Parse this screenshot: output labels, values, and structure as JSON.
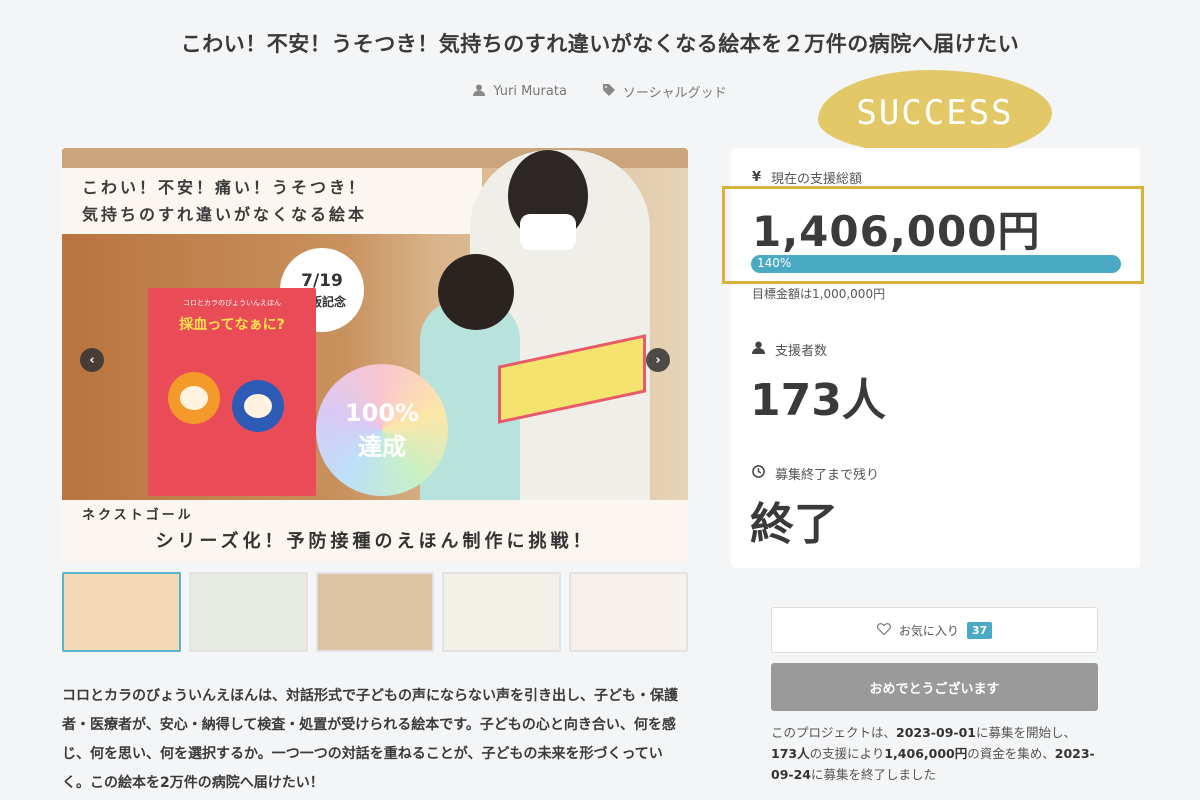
{
  "page": {
    "title": "こわい！不安！うそつき！気持ちのすれ違いがなくなる絵本を２万件の病院へ届けたい",
    "author": "Yuri Murata",
    "category": "ソーシャルグッド",
    "success_badge": "SUCCESS"
  },
  "hero": {
    "banner_line1": "こわい！不安！痛い！うそつき！",
    "banner_line2": "気持ちのすれ違いがなくなる絵本",
    "date": "7/19",
    "date_sub": "出版記念",
    "book_series": "コロとカラのびょういんえほん",
    "book_title": "採血ってなぁに?",
    "achieved_percent": "100%",
    "achieved_label": "達成",
    "next_goal": "ネクストゴール",
    "next_goal_text": "シリーズ化！予防接種のえほん制作に挑戦！",
    "prev_arrow": "‹",
    "next_arrow": "›"
  },
  "thumbnails": [
    {
      "color": "#f3d9b4",
      "active": true
    },
    {
      "color": "#e8ebe4",
      "active": false
    },
    {
      "color": "#dcc3a3",
      "active": false
    },
    {
      "color": "#f2efe6",
      "active": false
    },
    {
      "color": "#f5f1ea",
      "active": false
    }
  ],
  "description": "コロとカラのびょういんえほんは、対話形式で子どもの声にならない声を引き出し、子ども・保護者・医療者が、安心・納得して検査・処置が受けられる絵本です。子どもの心と向き合い、何を感じ、何を思い、何を選択するか。一つ一つの対話を重ねることが、子どもの未来を形づくっていく。この絵本を2万件の病院へ届けたい！",
  "stats": {
    "total_label": "現在の支援総額",
    "yen_icon": "¥",
    "total_amount": "1,406,000円",
    "progress_text": "140%",
    "progress_value": 1.4,
    "goal_text": "目標金額は1,000,000円",
    "supporters_label": "支援者数",
    "supporters": "173人",
    "remaining_label": "募集終了まで残り",
    "remaining": "終了"
  },
  "actions": {
    "favorite_label": "お気に入り",
    "favorite_count": "37",
    "congrats_label": "おめでとうございます"
  },
  "summary": {
    "p1": "このプロジェクトは、",
    "start": "2023-09-01",
    "p2": "に募集を開始し、",
    "count": "173人",
    "p3": "の支援により",
    "amount": "1,406,000円",
    "p4": "の資金を集め、",
    "end": "2023-09-24",
    "p5": "に募集を終了しました"
  },
  "colors": {
    "accent": "#4aa9c3",
    "gold_frame": "#d7b23c",
    "badge_bg": "#e2c867",
    "button_gray": "#9a9a9a"
  }
}
